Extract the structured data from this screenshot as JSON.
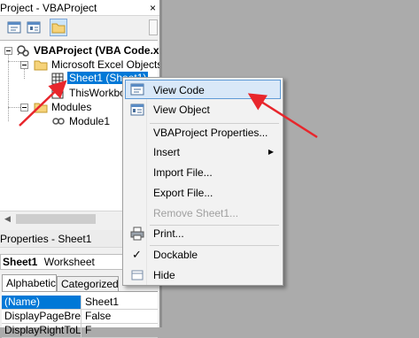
{
  "project_window": {
    "title": "Project - VBAProject",
    "close_glyph": "×"
  },
  "tree": {
    "root_label": "VBAProject (VBA Code.xl",
    "folder_excel_objects": "Microsoft Excel Objects",
    "sheet1_label": "Sheet1 (Sheet1)",
    "thisworkbook_label": "ThisWorkbo",
    "folder_modules": "Modules",
    "module1_label": "Module1"
  },
  "hscroll": {
    "left_arrow": "◀",
    "right_arrow": "▶"
  },
  "properties_window": {
    "title": "Properties - Sheet1",
    "close_glyph": "×",
    "object_name": "Sheet1",
    "object_type": "Worksheet",
    "tabs": [
      {
        "label": "Alphabetic"
      },
      {
        "label": "Categorized"
      }
    ],
    "rows": [
      {
        "name": "(Name)",
        "value": "Sheet1"
      },
      {
        "name": "DisplayPageBreak",
        "value": "False"
      },
      {
        "name": "DisplayRightToLe",
        "value": "F"
      }
    ]
  },
  "context_menu": {
    "items": [
      {
        "label": "View Code",
        "icon": "view-code-icon"
      },
      {
        "label": "View Object",
        "icon": "view-object-icon"
      },
      {
        "label": "VBAProject Properties..."
      },
      {
        "label": "Insert",
        "submenu_glyph": "▶"
      },
      {
        "label": "Import File..."
      },
      {
        "label": "Export File..."
      },
      {
        "label": "Remove Sheet1..."
      },
      {
        "label": "Print...",
        "icon": "printer-icon"
      },
      {
        "label": "Dockable",
        "check": "✓"
      },
      {
        "label": "Hide",
        "icon": "hide-icon"
      }
    ]
  },
  "colors": {
    "selection": "#0078d7",
    "menu_hover": "#d9e8f8",
    "annotation_arrow": "#e8262c"
  }
}
